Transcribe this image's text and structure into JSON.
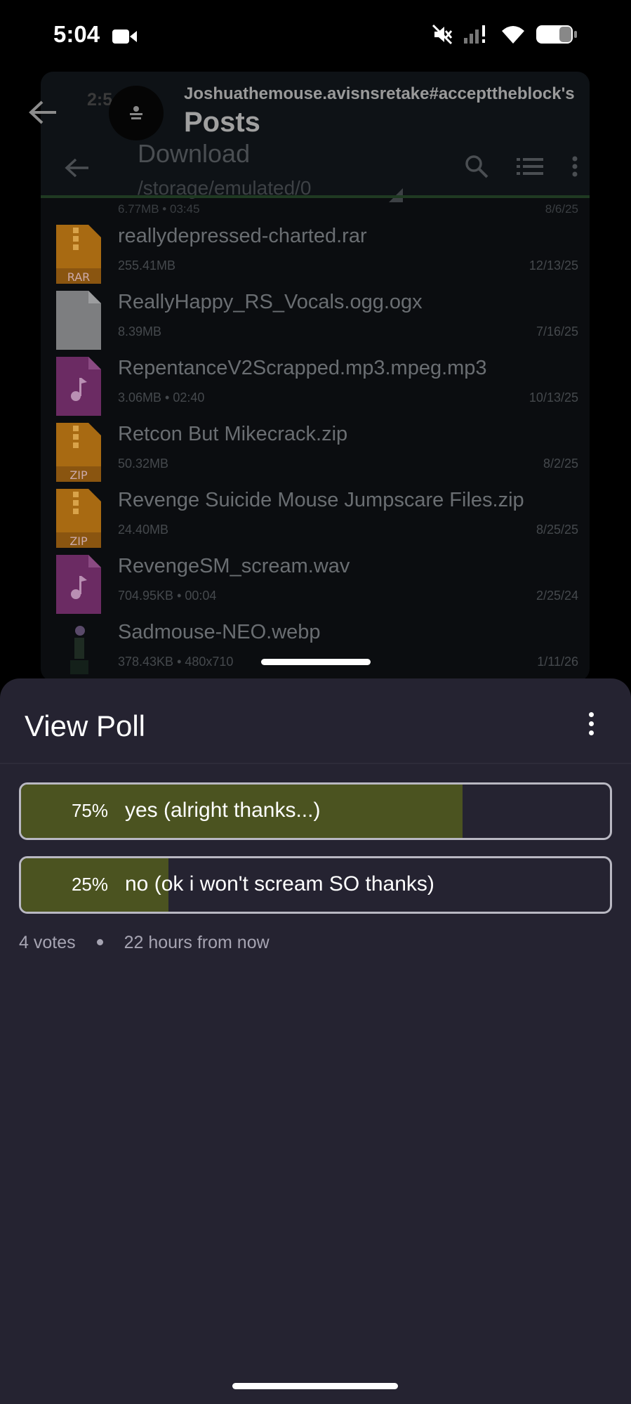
{
  "status_bar": {
    "time": "5:04",
    "icons": [
      "video-camera-icon",
      "mute-icon",
      "signal-icon",
      "wifi-icon",
      "battery-icon"
    ]
  },
  "background_app": {
    "ghost_time": "2:5",
    "username": "Joshuathemouse.avisnsretake#accepttheblock's",
    "title": "Posts",
    "file_manager": {
      "title": "Download",
      "path": "/storage/emulated/0",
      "cut_row_meta": "6.77MB  • 03:45",
      "cut_row_date": "8/6/25",
      "files": [
        {
          "name": "reallydepressed-charted.rar",
          "meta": "255.41MB",
          "date": "12/13/25",
          "type": "RAR"
        },
        {
          "name": "ReallyHappy_RS_Vocals.ogg.ogx",
          "meta": "8.39MB",
          "date": "7/16/25",
          "type": "generic"
        },
        {
          "name": "RepentanceV2Scrapped.mp3.mpeg.mp3",
          "meta": "3.06MB  • 02:40",
          "date": "10/13/25",
          "type": "audio"
        },
        {
          "name": "Retcon But Mikecrack.zip",
          "meta": "50.32MB",
          "date": "8/2/25",
          "type": "ZIP"
        },
        {
          "name": "Revenge Suicide Mouse Jumpscare Files.zip",
          "meta": "24.40MB",
          "date": "8/25/25",
          "type": "ZIP"
        },
        {
          "name": "RevengeSM_scream.wav",
          "meta": "704.95KB  • 00:04",
          "date": "2/25/24",
          "type": "audio"
        },
        {
          "name": "Sadmouse-NEO.webp",
          "meta": "378.43KB  • 480x710",
          "date": "1/11/26",
          "type": "image"
        }
      ]
    }
  },
  "sheet": {
    "title": "View Poll",
    "options": [
      {
        "percent_label": "75%",
        "label": "yes (alright thanks...)",
        "fraction": 0.75
      },
      {
        "percent_label": "25%",
        "label": "no (ok i won't scream SO thanks)",
        "fraction": 0.25
      }
    ],
    "votes": "4 votes",
    "time_left": "22 hours from now"
  },
  "colors": {
    "sheet_bg": "#252331",
    "poll_fill": "#4b5320",
    "poll_border": "#b9b8c2",
    "muted_text": "#a6a4b2"
  }
}
